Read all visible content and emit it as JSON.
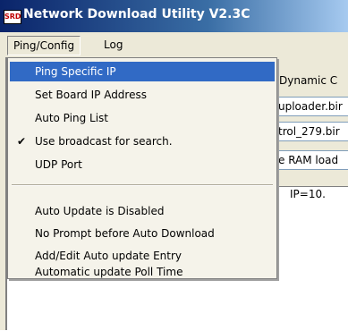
{
  "window": {
    "title": "Network Download Utility V2.3C",
    "icon_text": "SRD"
  },
  "menubar": {
    "items": [
      {
        "label": "Ping/Config"
      },
      {
        "label": "Log"
      }
    ]
  },
  "dropdown": {
    "items": [
      {
        "label": "Ping Specific IP"
      },
      {
        "label": "Set Board IP Address"
      },
      {
        "label": "Auto Ping List"
      },
      {
        "label": "Use broadcast for search."
      },
      {
        "label": "UDP Port"
      },
      {
        "label": "Auto Update is Disabled"
      },
      {
        "label": "No Prompt before Auto Download"
      },
      {
        "label": "Add/Edit Auto update Entry"
      },
      {
        "label": "Automatic update Poll Time"
      }
    ]
  },
  "background": {
    "header_text": "Dynamic C",
    "field1": "uploader.bir",
    "field2": "trol_279.bir",
    "field3": "e RAM load",
    "ip_text": "IP=10."
  }
}
